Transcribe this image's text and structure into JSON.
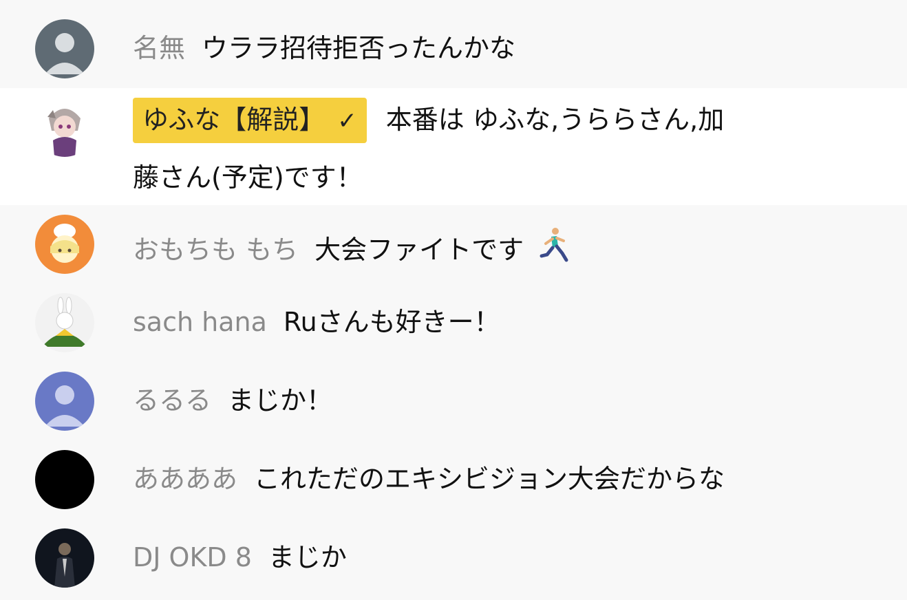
{
  "messages": [
    {
      "author": "名無",
      "text": "ウララ招待拒否ったんかな"
    },
    {
      "author": "ゆふな【解説】",
      "badge_check": "✓",
      "text_line1": "本番は ゆふな,うららさん,加",
      "text_line2": "藤さん(予定)です！"
    },
    {
      "author": "おもちも もち",
      "text": "大会ファイトです",
      "emoji": "person-running"
    },
    {
      "author": "sach hana",
      "text": "Ruさんも好きー！"
    },
    {
      "author": "るるる",
      "text": "まじか！"
    },
    {
      "author": "ああああ",
      "text": "これただのエキシビジョン大会だからな"
    },
    {
      "author": "DJ OKD 8",
      "text": "まじか"
    }
  ],
  "colors": {
    "background": "#f8f8f8",
    "highlight_row": "#ffffff",
    "moderator_badge": "#f5cf3e",
    "author_text": "#8a8a8a",
    "message_text": "#111111"
  }
}
